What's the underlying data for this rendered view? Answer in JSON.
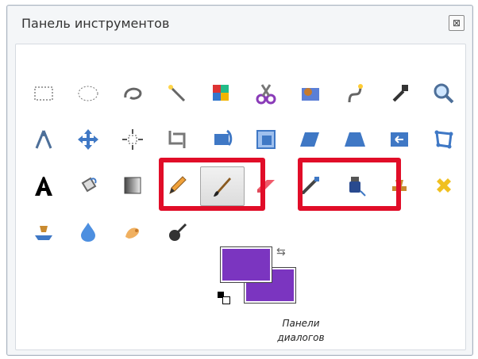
{
  "window": {
    "title": "Панель инструментов",
    "close_glyph": "⊠"
  },
  "colors": {
    "foreground": "#7b35c0",
    "background": "#7b35c0",
    "highlight": "#e10d28"
  },
  "tools": [
    {
      "name": "rect-select-icon"
    },
    {
      "name": "ellipse-select-icon"
    },
    {
      "name": "free-select-icon"
    },
    {
      "name": "fuzzy-select-icon"
    },
    {
      "name": "color-select-icon"
    },
    {
      "name": "scissors-select-icon"
    },
    {
      "name": "foreground-select-icon"
    },
    {
      "name": "paths-icon"
    },
    {
      "name": "color-picker-icon"
    },
    {
      "name": "zoom-icon"
    },
    {
      "name": "measure-icon"
    },
    {
      "name": "move-icon"
    },
    {
      "name": "align-icon"
    },
    {
      "name": "crop-icon"
    },
    {
      "name": "rotate-icon"
    },
    {
      "name": "scale-icon"
    },
    {
      "name": "shear-icon"
    },
    {
      "name": "perspective-icon"
    },
    {
      "name": "flip-icon"
    },
    {
      "name": "cage-transform-icon"
    },
    {
      "name": "text-icon"
    },
    {
      "name": "bucket-fill-icon"
    },
    {
      "name": "blend-icon"
    },
    {
      "name": "pencil-icon"
    },
    {
      "name": "paintbrush-icon"
    },
    {
      "name": "eraser-icon"
    },
    {
      "name": "airbrush-icon"
    },
    {
      "name": "ink-icon"
    },
    {
      "name": "clone-icon"
    },
    {
      "name": "heal-icon"
    },
    {
      "name": "perspective-clone-icon"
    },
    {
      "name": "blur-sharpen-icon"
    },
    {
      "name": "smudge-icon"
    },
    {
      "name": "dodge-burn-icon"
    }
  ],
  "caption": {
    "line1": "Панели",
    "line2": "диалогов"
  }
}
